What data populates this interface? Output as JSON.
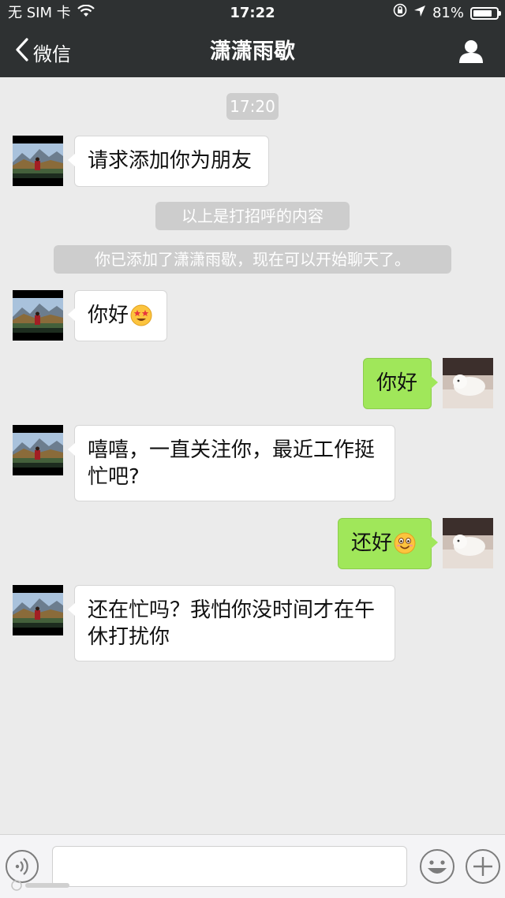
{
  "status_bar": {
    "carrier": "无 SIM 卡",
    "time": "17:22",
    "battery_text": "81%",
    "battery_level": 0.81,
    "icons": [
      "wifi-icon",
      "orientation-lock-icon",
      "location-arrow-icon",
      "battery-icon"
    ]
  },
  "nav": {
    "back_label": "微信",
    "title": "潇潇雨歇",
    "right_icon": "profile-icon"
  },
  "chat": {
    "timestamp": "17:20",
    "system_notes": [
      "以上是打招呼的内容",
      "你已添加了潇潇雨歇，现在可以开始聊天了。"
    ],
    "messages": [
      {
        "side": "in",
        "text": "请求添加你为朋友"
      },
      {
        "side": "in",
        "text": "你好",
        "emoji": "starry-eyes-emoji"
      },
      {
        "side": "out",
        "text": "你好"
      },
      {
        "side": "in",
        "text": "嘻嘻，一直关注你，最近工作挺忙吧?"
      },
      {
        "side": "out",
        "text": "还好",
        "emoji": "smile-emoji"
      },
      {
        "side": "in",
        "text": "还在忙吗？我怕你没时间才在午休打扰你"
      }
    ]
  },
  "input_bar": {
    "value": "",
    "icons": [
      "voice-icon",
      "emoji-icon",
      "plus-icon"
    ]
  },
  "colors": {
    "nav_bg": "#2e3132",
    "chat_bg": "#ebebeb",
    "outgoing_bubble": "#a0e75a",
    "incoming_bubble": "#ffffff",
    "system_chip": "#cdcdcd"
  }
}
